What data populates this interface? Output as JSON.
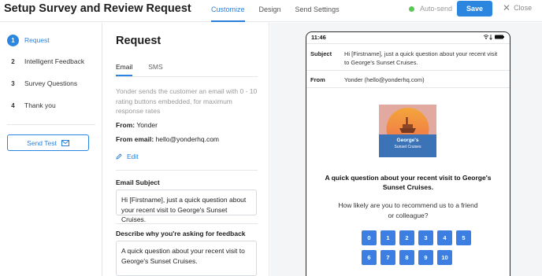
{
  "header": {
    "title": "Setup Survey and Review Request",
    "tabs": [
      {
        "label": "Customize",
        "active": true
      },
      {
        "label": "Design",
        "active": false
      },
      {
        "label": "Send Settings",
        "active": false
      }
    ],
    "autosend_label": "Auto-send",
    "save_label": "Save",
    "close_label": "Close"
  },
  "sidebar": {
    "steps": [
      {
        "num": "1",
        "label": "Request",
        "active": true
      },
      {
        "num": "2",
        "label": "Intelligent Feedback",
        "active": false
      },
      {
        "num": "3",
        "label": "Survey Questions",
        "active": false
      },
      {
        "num": "4",
        "label": "Thank you",
        "active": false
      }
    ],
    "send_test_label": "Send Test"
  },
  "editor": {
    "title": "Request",
    "subtabs": [
      {
        "label": "Email",
        "active": true
      },
      {
        "label": "SMS",
        "active": false
      }
    ],
    "description": "Yonder sends the customer an email with 0 - 10 rating buttons embedded, for maximum response rates",
    "from_label": "From:",
    "from_value": "Yonder",
    "from_email_label": "From email:",
    "from_email_value": "hello@yonderhq.com",
    "edit_label": "Edit",
    "email_subject_label": "Email Subject",
    "email_subject_value": "Hi [Firstname], just a quick question about your recent visit to George's Sunset Cruises.",
    "describe_label": "Describe why you're asking for feedback",
    "describe_value": "A quick question about your recent visit to George's Sunset Cruises."
  },
  "preview": {
    "time": "11:46",
    "subject_label": "Subject",
    "subject_value": "Hi [Firstname], just a quick question about your recent visit to George's Sunset Cruises.",
    "from_label": "From",
    "from_value": "Yonder (hello@yonderhq.com)",
    "logo_text_line1": "George's",
    "logo_text_line2": "Sunset Cruises",
    "heading": "A quick question about your recent visit to George's Sunset Cruises.",
    "question": "How likely are you to recommend us to a friend or colleague?",
    "rating_values": [
      "0",
      "1",
      "2",
      "3",
      "4",
      "5",
      "6",
      "7",
      "8",
      "9",
      "10"
    ]
  },
  "colors": {
    "accent": "#2b86e0",
    "autosend_dot": "#5cc65a",
    "rating_button": "#3d7ee2"
  },
  "icons": {
    "send_test": "envelope-icon",
    "edit": "pencil-icon",
    "close": "close-icon"
  }
}
